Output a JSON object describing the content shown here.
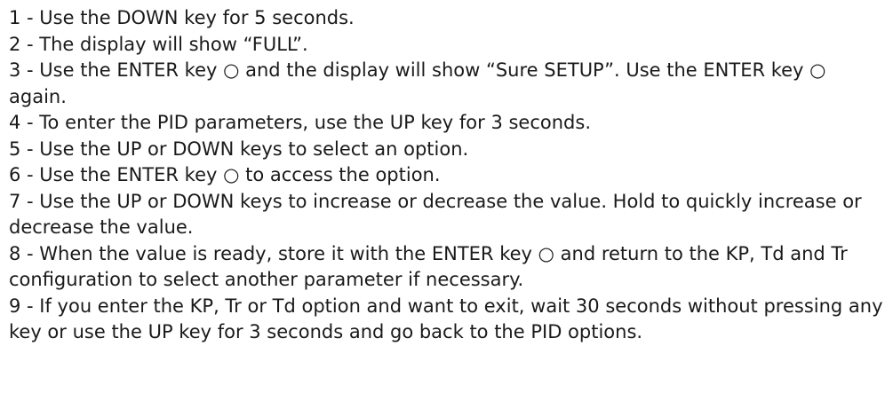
{
  "steps": [
    "1 - Use the DOWN key for 5 seconds.",
    "2 - The display will show “FULL”.",
    "3 - Use the ENTER key ○ and the display will show “Sure SETUP”. Use the ENTER key ○ again.",
    "4 - To enter the PID parameters, use the UP key for 3 seconds.",
    "5 - Use the UP or DOWN keys to select an option.",
    "6 - Use the ENTER key ○ to access the option.",
    "7 - Use the UP or DOWN keys to increase or decrease the value. Hold to quickly increase or decrease the value.",
    "8 - When the value is ready, store it with the ENTER key ○ and return to the KP, Td and Tr configuration to select another parameter if necessary.",
    "9 - If you enter the KP, Tr or Td option and want to exit, wait 30 seconds without pressing any key or use the UP key for 3 seconds and go back to the PID options."
  ]
}
